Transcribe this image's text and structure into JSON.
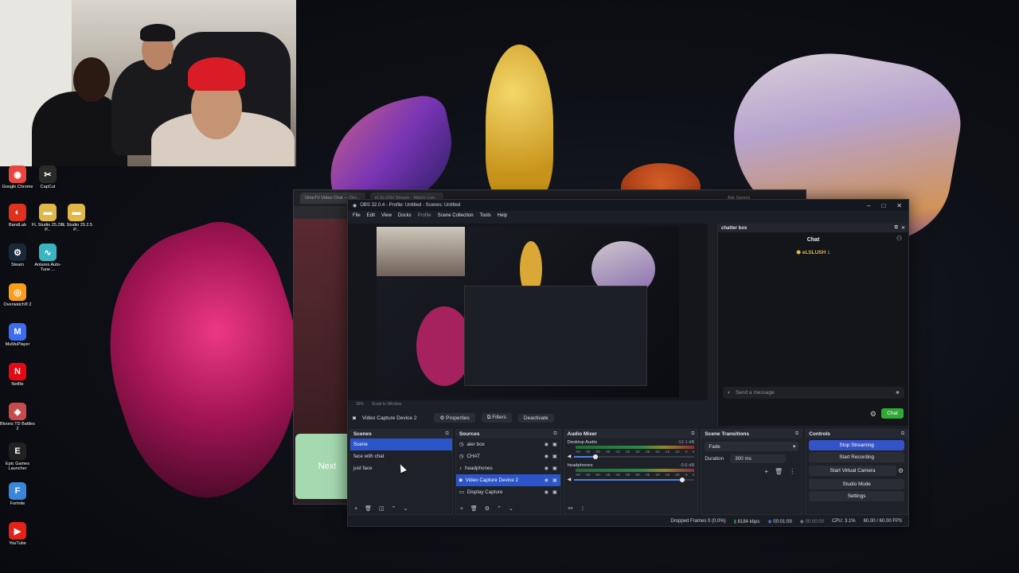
{
  "desktop": {
    "icons": [
      {
        "label": "Google Chrome",
        "icon": "chrome-icon",
        "color": "#e8453c"
      },
      {
        "label": "CapCut",
        "icon": "capcut-icon",
        "color": "#2a2a2a"
      },
      {
        "label": "BandLab",
        "icon": "bandlab-icon",
        "color": "#e0301e"
      },
      {
        "label": "FL Studio 25.2.5 P...",
        "icon": "folder-icon",
        "color": "#e0b84a"
      },
      {
        "label": "FL Studio 25.2.5 P...",
        "icon": "folder-icon",
        "color": "#e0b84a"
      },
      {
        "label": "Steam",
        "icon": "steam-icon",
        "color": "#1b2838"
      },
      {
        "label": "Antares Auto-Tune ...",
        "icon": "autotune-icon",
        "color": "#3bb4c1"
      },
      {
        "label": "Overwatch® 2",
        "icon": "overwatch-icon",
        "color": "#f99e1a"
      },
      {
        "label": "MuMuPlayer",
        "icon": "mumu-icon",
        "color": "#3c6df0"
      },
      {
        "label": "Netflix",
        "icon": "netflix-icon",
        "color": "#e50914"
      },
      {
        "label": "Bloons TD Battles 2",
        "icon": "bloons-icon",
        "color": "#c84b4b"
      },
      {
        "label": "Epic Games Launcher",
        "icon": "epic-icon",
        "color": "#222"
      },
      {
        "label": "Fortnite",
        "icon": "fortnite-icon",
        "color": "#3a86d8"
      },
      {
        "label": "YouTube",
        "icon": "youtube-icon",
        "color": "#e62117"
      }
    ]
  },
  "browser": {
    "tabs": [
      "OmeTV Video Chat — Om...",
      "eLSLUSH Stream - Watch Live...",
      "Ask Gemini"
    ],
    "next_label": "Next"
  },
  "obs": {
    "title": "OBS 32.0.4 - Profile: Untitled - Scenes: Untitled",
    "menu": [
      "File",
      "Edit",
      "View",
      "Docks",
      "Profile",
      "Scene Collection",
      "Tools",
      "Help"
    ],
    "preview_zoom": "39%",
    "preview_scale": "Scale to Window",
    "source_bar": {
      "source_name": "Video Capture Device 2",
      "properties": "Properties",
      "filters": "Filters",
      "deactivate": "Deactivate"
    },
    "chat_dock": {
      "header": "chatter box",
      "title": "Chat",
      "user": "eLSLUSH",
      "user_count": "1",
      "placeholder": "Send a message",
      "send": "Chat"
    },
    "scenes": {
      "header": "Scenes",
      "items": [
        "Scene",
        "face with chat",
        "just face"
      ],
      "selected": 0
    },
    "sources": {
      "header": "Sources",
      "items": [
        "aler box",
        "CHAT",
        "headphones",
        "Video Capture Device 2",
        "Display Capture"
      ],
      "selected": 3
    },
    "mixer": {
      "header": "Audio Mixer",
      "channels": [
        {
          "name": "Desktop Audio",
          "db": "-12.1 dB",
          "level": 0.18
        },
        {
          "name": "headphones",
          "db": "-0.6 dB",
          "level": 0.9
        }
      ],
      "scale": [
        "-60",
        "-55",
        "-50",
        "-45",
        "-40",
        "-35",
        "-30",
        "-25",
        "-20",
        "-15",
        "-10",
        "-5",
        "0"
      ]
    },
    "transitions": {
      "header": "Scene Transitions",
      "type": "Fade",
      "duration_label": "Duration",
      "duration": "300 ms"
    },
    "controls": {
      "header": "Controls",
      "buttons": [
        "Stop Streaming",
        "Start Recording",
        "Start Virtual Camera",
        "Studio Mode",
        "Settings"
      ]
    },
    "status": {
      "dropped": "Dropped Frames 0 (0.0%)",
      "bitrate": "8184 kbps",
      "stream_time": "00:01:09",
      "rec_time": "00:00:00",
      "cpu": "CPU: 3.1%",
      "fps": "60.00 / 60.00 FPS"
    }
  },
  "colors": {
    "accent": "#3553c9",
    "selection": "#2b55c8",
    "chat_send": "#2fa836",
    "stream_green": "#2f9a4a"
  }
}
